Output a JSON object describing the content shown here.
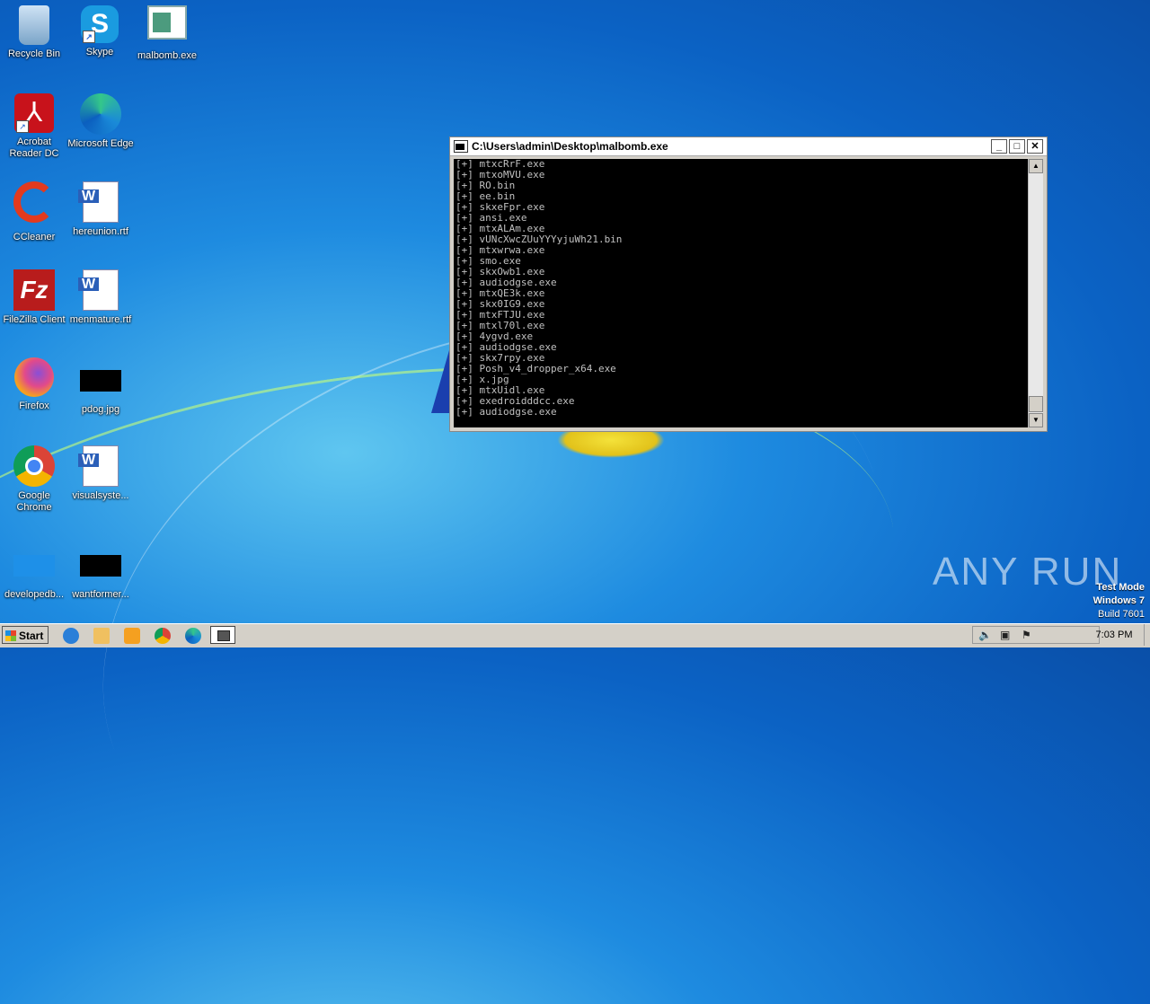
{
  "desktop": {
    "icons": [
      {
        "label": "Recycle Bin"
      },
      {
        "label": "Skype"
      },
      {
        "label": "malbomb.exe"
      },
      {
        "label": "Acrobat Reader DC"
      },
      {
        "label": "Microsoft Edge"
      },
      {
        "label": "CCleaner"
      },
      {
        "label": "hereunion.rtf"
      },
      {
        "label": "FileZilla Client"
      },
      {
        "label": "menmature.rtf"
      },
      {
        "label": "Firefox"
      },
      {
        "label": "pdog.jpg"
      },
      {
        "label": "Google Chrome"
      },
      {
        "label": "visualsyste..."
      },
      {
        "label": "developedb..."
      },
      {
        "label": "wantformer..."
      }
    ]
  },
  "console_window": {
    "title": "C:\\Users\\admin\\Desktop\\malbomb.exe",
    "lines": [
      "[+] mtxcRrF.exe",
      "[+] mtxoMVU.exe",
      "[+] RO.bin",
      "[+] ee.bin",
      "[+] skxeFpr.exe",
      "[+] ansi.exe",
      "[+] mtxALAm.exe",
      "[+] vUNcXwcZUuYYYyjuWh21.bin",
      "[+] mtxwrwa.exe",
      "[+] smo.exe",
      "[+] skxOwb1.exe",
      "[+] audiodgse.exe",
      "[+] mtxQE3k.exe",
      "[+] skx0IG9.exe",
      "[+] mtxFTJU.exe",
      "[+] mtxl70l.exe",
      "[+] 4ygvd.exe",
      "[+] audiodgse.exe",
      "[+] skx7rpy.exe",
      "[+] Posh_v4_dropper_x64.exe",
      "[+] x.jpg",
      "[+] mtxUidl.exe",
      "[+] exedroidddcc.exe",
      "[+] audiodgse.exe"
    ]
  },
  "watermark": {
    "brand": "ANY RUN",
    "test_mode": "Test Mode",
    "os": "Windows 7",
    "build": "Build 7601"
  },
  "taskbar": {
    "start_label": "Start",
    "clock": "7:03 PM"
  }
}
